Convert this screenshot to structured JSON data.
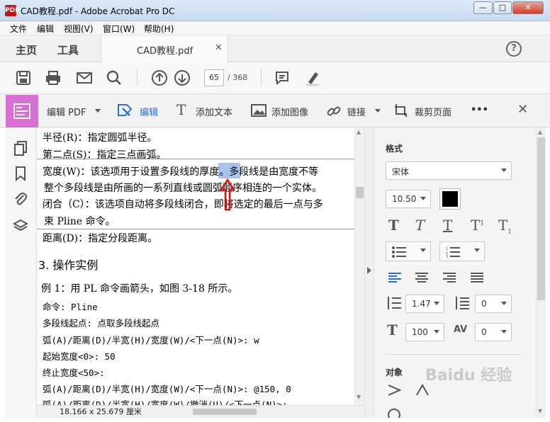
{
  "window": {
    "title": "CAD教程.pdf - Adobe Acrobat Pro DC",
    "app_icon": "PDF",
    "btn_min": "—",
    "btn_max": "□",
    "btn_close": "✕"
  },
  "menu": [
    "文件",
    "编辑",
    "视图(V)",
    "窗口(W)",
    "帮助(H)"
  ],
  "tabs": {
    "home": "主页",
    "tools": "工具",
    "doc": "CAD教程.pdf",
    "doc_close": "✕",
    "help": "?"
  },
  "toolbar": {
    "page_current": "65",
    "page_total": "/ 368"
  },
  "editbar": {
    "edit_pdf": "编辑 PDF",
    "edit": "编辑",
    "add_text": "添加文本",
    "add_image": "添加图像",
    "link": "链接",
    "crop": "裁剪页面",
    "more": "•••",
    "close": "✕"
  },
  "document": {
    "lines": [
      "半径(R)：指定圆弧半径。",
      "第二点(S)：指定三点画弧。",
      "宽度(W)：该选项用于设置多段线的厚度。多段线是由宽度不等",
      "整个多段线是由所画的一系列直线或圆弧顺序相连的一个实体。",
      "闭合（C）：该选项自动将多段线闭合，即将选定的最后一点与多",
      "束 Pline 命令。",
      "距离(D)：指定分段距离。",
      "3. 操作实例",
      "例 1：用 PL 命令画箭头，如图 3-18 所示。",
      "命令: Pline",
      "多段线起点: 点取多段线起点",
      "弧(A)/距离(D)/半宽(H)/宽度(W)/<下一点(N)>: w",
      "起始宽度<0>: 50",
      "终止宽度<50>:",
      "弧(A)/距离(D)/半宽(H)/宽度(W)/<下一点(N)>: @150, 0",
      "弧(A)/距离(D)/半宽(H)/宽度(W)/撤消(U)/<下一点(N)>:"
    ],
    "dimensions": "18.166 x 25.679 厘米"
  },
  "format_panel": {
    "title": "格式",
    "font": "宋体",
    "size": "10.50",
    "color": "#000000",
    "line_spacing": "1.47",
    "para_spacing": "0",
    "scale": "100",
    "char_spacing": "0"
  },
  "object_panel": {
    "title": "对象"
  },
  "watermark": "Baidu 经验",
  "colors": {
    "edit_accent": "#d76fd6",
    "link_blue": "#2a6fdb",
    "highlight": "#a7c4e8",
    "arrow": "#e01010"
  }
}
